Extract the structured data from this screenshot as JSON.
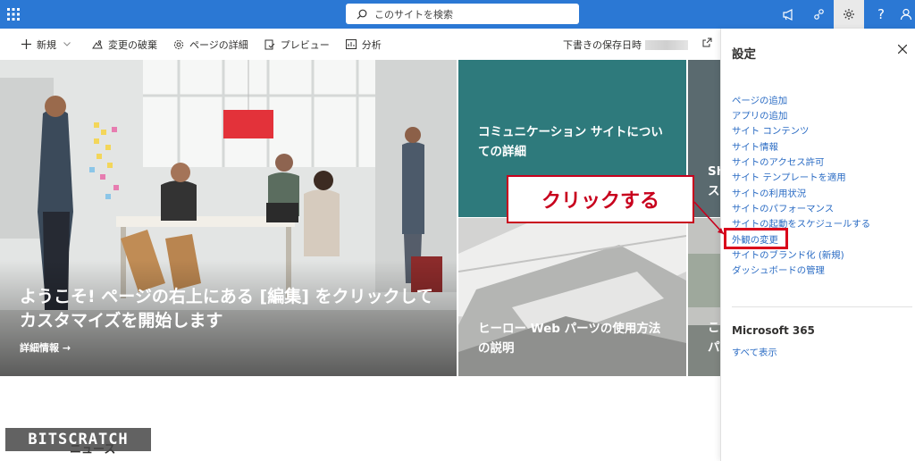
{
  "topbar": {
    "search_placeholder": "このサイトを検索",
    "icons": [
      "waffle-icon",
      "megaphone-icon",
      "share-people-icon",
      "gear-icon",
      "help-icon",
      "person-icon"
    ]
  },
  "commandbar": {
    "new": "新規",
    "discard": "変更の破棄",
    "page_details": "ページの詳細",
    "preview": "プレビュー",
    "analytics": "分析",
    "saved_label": "下書きの保存日時"
  },
  "hero": {
    "main_title": "ようこそ! ページの右上にある [編集] をクリックしてカスタマイズを開始します",
    "main_link": "詳細情報",
    "tile1_title": "コミュニケーション サイトについての詳細",
    "tile2_title": "ヒーロー Web パーツの使用方法の説明",
    "tile3_partial": "Sh\nス",
    "tile4_partial": "こ\nパ"
  },
  "news_title": "ニュース",
  "watermark": "BITSCRATCH",
  "settings_panel": {
    "title": "設定",
    "links": [
      "ページの追加",
      "アプリの追加",
      "サイト コンテンツ",
      "サイト情報",
      "サイトのアクセス許可",
      "サイト テンプレートを適用",
      "サイトの利用状況",
      "サイトのパフォーマンス",
      "サイトの起動をスケジュールする",
      "外観の変更",
      "サイトのブランド化 (新規)",
      "ダッシュボードの管理"
    ],
    "ms365_title": "Microsoft 365",
    "show_all": "すべて表示"
  },
  "annotation": {
    "callout_text": "クリックする",
    "color": "#c8001d"
  }
}
